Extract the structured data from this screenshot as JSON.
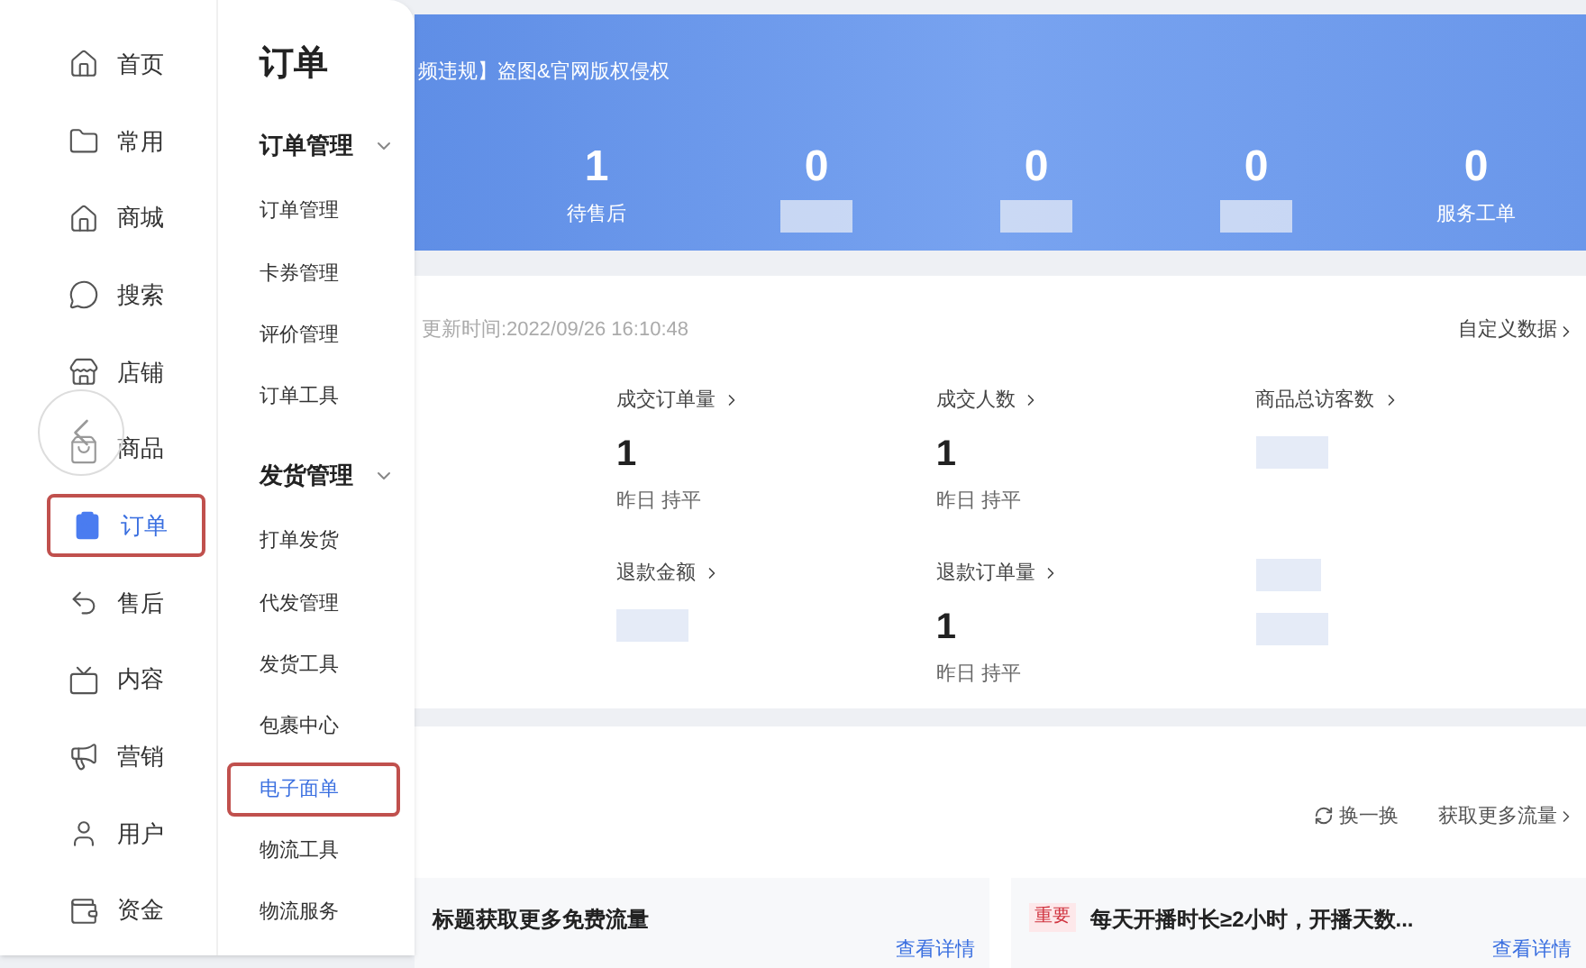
{
  "nav": {
    "items": [
      {
        "label": "首页",
        "selected": false
      },
      {
        "label": "常用",
        "selected": false
      },
      {
        "label": "商城",
        "selected": false
      },
      {
        "label": "搜索",
        "selected": false
      },
      {
        "label": "店铺",
        "selected": false
      },
      {
        "label": "商品",
        "selected": false
      },
      {
        "label": "订单",
        "selected": true
      },
      {
        "label": "售后",
        "selected": false
      },
      {
        "label": "内容",
        "selected": false
      },
      {
        "label": "营销",
        "selected": false
      },
      {
        "label": "用户",
        "selected": false
      },
      {
        "label": "资金",
        "selected": false
      }
    ]
  },
  "submenu": {
    "title": "订单",
    "groups": [
      {
        "title": "订单管理",
        "expanded": true,
        "items": [
          {
            "label": "订单管理",
            "selected": false
          },
          {
            "label": "卡券管理",
            "selected": false
          },
          {
            "label": "评价管理",
            "selected": false
          },
          {
            "label": "订单工具",
            "selected": false
          }
        ]
      },
      {
        "title": "发货管理",
        "expanded": true,
        "items": [
          {
            "label": "打单发货",
            "selected": false
          },
          {
            "label": "代发管理",
            "selected": false
          },
          {
            "label": "发货工具",
            "selected": false
          },
          {
            "label": "包裹中心",
            "selected": false
          },
          {
            "label": "电子面单",
            "selected": true
          },
          {
            "label": "物流工具",
            "selected": false
          },
          {
            "label": "物流服务",
            "selected": false
          }
        ]
      }
    ]
  },
  "banner": {
    "notice": "频违规】盗图&官网版权侵权",
    "stats": [
      {
        "value": "1",
        "label": "待售后"
      },
      {
        "value": "0"
      },
      {
        "value": "0"
      },
      {
        "value": "0"
      },
      {
        "value": "0",
        "label": "服务工单"
      }
    ]
  },
  "overview": {
    "update_time": "更新时间:2022/09/26 16:10:48",
    "custom_link": "自定义数据",
    "metrics": [
      {
        "title": "成交订单量",
        "value": "1",
        "compare": "昨日 持平"
      },
      {
        "title": "成交人数",
        "value": "1",
        "compare": "昨日 持平"
      },
      {
        "title": "商品总访客数"
      },
      {
        "title": "退款金额"
      },
      {
        "title": "退款订单量",
        "value": "1",
        "compare": "昨日 持平"
      }
    ]
  },
  "traffic": {
    "refresh": "换一换",
    "more": "获取更多流量",
    "cards": [
      {
        "text": "标题获取更多免费流量",
        "link": "查看详情"
      },
      {
        "tag": "重要",
        "text": "每天开播时长≥2小时，开播天数...",
        "link": "查看详情"
      }
    ]
  }
}
